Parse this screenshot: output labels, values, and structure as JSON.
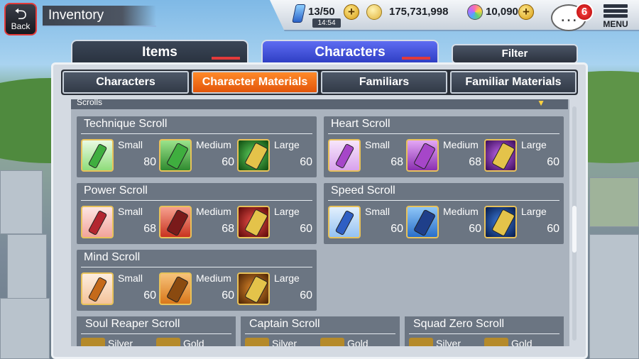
{
  "header": {
    "back_label": "Back",
    "title": "Inventory",
    "stamina": "13/50",
    "timer": "14:54",
    "coins": "175,731,998",
    "orbs": "10,090",
    "notifications": "6",
    "menu_label": "MENU"
  },
  "top_tabs": [
    {
      "label": "Items"
    },
    {
      "label": "Characters"
    }
  ],
  "filter_label": "Filter",
  "sub_tabs": [
    {
      "label": "Characters"
    },
    {
      "label": "Character Materials"
    },
    {
      "label": "Familiars"
    },
    {
      "label": "Familiar Materials"
    }
  ],
  "section_label": "Scrolls",
  "cards": [
    {
      "title": "Technique Scroll",
      "color": "#3fae3f",
      "slots": [
        {
          "size": "Small",
          "qty": "80"
        },
        {
          "size": "Medium",
          "qty": "60"
        },
        {
          "size": "Large",
          "qty": "60"
        }
      ]
    },
    {
      "title": "Heart Scroll",
      "color": "#a646c9",
      "slots": [
        {
          "size": "Small",
          "qty": "68"
        },
        {
          "size": "Medium",
          "qty": "68"
        },
        {
          "size": "Large",
          "qty": "60"
        }
      ]
    },
    {
      "title": "Power Scroll",
      "color": "#b3262f",
      "slots": [
        {
          "size": "Small",
          "qty": "68"
        },
        {
          "size": "Medium",
          "qty": "68"
        },
        {
          "size": "Large",
          "qty": "60"
        }
      ]
    },
    {
      "title": "Speed Scroll",
      "color": "#2f5fc4",
      "slots": [
        {
          "size": "Small",
          "qty": "60"
        },
        {
          "size": "Medium",
          "qty": "60"
        },
        {
          "size": "Large",
          "qty": "60"
        }
      ]
    },
    {
      "title": "Mind Scroll",
      "color": "#c56a1a",
      "slots": [
        {
          "size": "Small",
          "qty": "60"
        },
        {
          "size": "Medium",
          "qty": "60"
        },
        {
          "size": "Large",
          "qty": "60"
        }
      ]
    }
  ],
  "bottom_cards": [
    {
      "title": "Soul Reaper Scroll",
      "a": "Silver",
      "b": "Gold"
    },
    {
      "title": "Captain Scroll",
      "a": "Silver",
      "b": "Gold"
    },
    {
      "title": "Squad Zero Scroll",
      "a": "Silver",
      "b": "Gold"
    }
  ]
}
